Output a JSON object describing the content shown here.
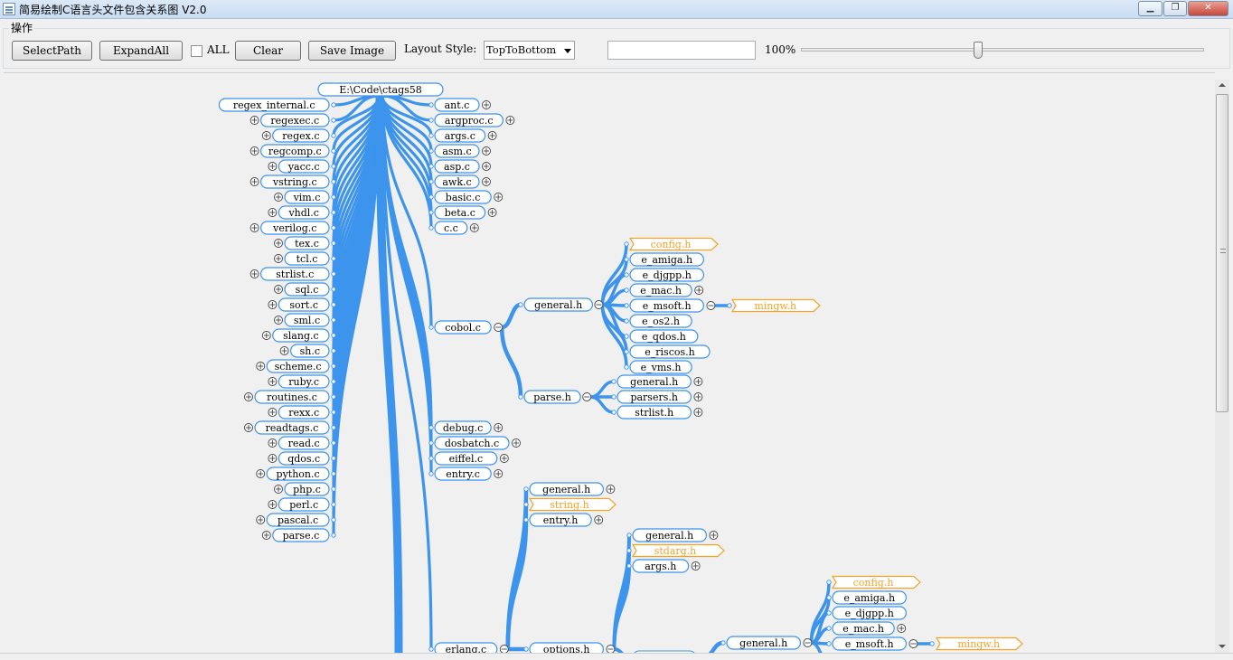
{
  "window": {
    "title": "简易绘制C语言头文件包含关系图 V2.0",
    "min_glyph": "▁",
    "max_glyph": "❐",
    "close_glyph": "✕"
  },
  "toolbar": {
    "group_label": "操作",
    "select_path": "SelectPath",
    "expand_all": "ExpandAll",
    "all_label": "ALL",
    "all_checked": false,
    "clear": "Clear",
    "save_image": "Save Image",
    "layout_style_label": "Layout Style:",
    "layout_style_value": "TopToBottom",
    "path_input_value": "",
    "zoom_text": "100%",
    "zoom_level": 0.44
  },
  "colors": {
    "edge": "#3d94ec",
    "node_border": "#3d94ec",
    "header_border": "#f3a328",
    "header_text": "#f3a328",
    "text": "#000000"
  },
  "graph": {
    "root": "E:\\Code\\ctags58",
    "left_files": [
      "regex_internal.c",
      "regexec.c",
      "regex.c",
      "regcomp.c",
      "yacc.c",
      "vstring.c",
      "vim.c",
      "vhdl.c",
      "verilog.c",
      "tex.c",
      "tcl.c",
      "strlist.c",
      "sql.c",
      "sort.c",
      "sml.c",
      "slang.c",
      "sh.c",
      "scheme.c",
      "ruby.c",
      "routines.c",
      "rexx.c",
      "readtags.c",
      "read.c",
      "qdos.c",
      "python.c",
      "php.c",
      "perl.c",
      "pascal.c",
      "parse.c"
    ],
    "right_files_top": [
      "ant.c",
      "argproc.c",
      "args.c",
      "asm.c",
      "asp.c",
      "awk.c",
      "basic.c",
      "beta.c",
      "c.c"
    ],
    "cobol": "cobol.c",
    "cobol_general": "general.h",
    "cobol_general_children": [
      "config.h",
      "e_amiga.h",
      "e_djgpp.h",
      "e_mac.h",
      "e_msoft.h",
      "e_os2.h",
      "e_qdos.h",
      "e_riscos.h",
      "e_vms.h"
    ],
    "mingw": "_mingw.h",
    "cobol_parse": "parse.h",
    "cobol_parse_children": [
      "general.h",
      "parsers.h",
      "strlist.h"
    ],
    "right_files_mid": [
      "debug.c",
      "dosbatch.c",
      "eiffel.c",
      "entry.c"
    ],
    "erlang_upper_children": [
      "general.h",
      "string.h",
      "entry.h"
    ],
    "options_children": [
      "general.h",
      "stdarg.h",
      "args.h"
    ],
    "general2_children": [
      "config.h",
      "e_amiga.h",
      "e_djgpp.h",
      "e_mac.h",
      "e_msoft.h"
    ],
    "erlang": "erlang.c",
    "options": "options.h",
    "general2": "general.h",
    "mingw2": "_mingw.h"
  }
}
